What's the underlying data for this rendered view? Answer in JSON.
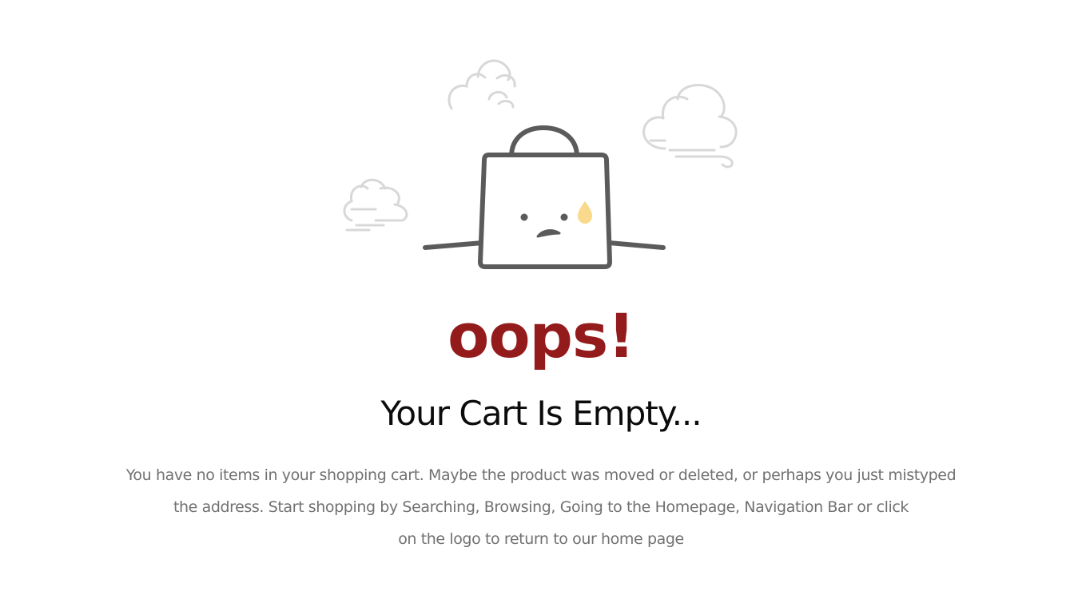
{
  "empty_cart": {
    "title": "oops!",
    "headline": "Your Cart Is Empty...",
    "message_lines": [
      "You have no items in your shopping cart. Maybe the product was moved or deleted, or perhaps you just mistyped",
      "the address. Start shopping by Searching, Browsing, Going to the Homepage, Navigation Bar or click",
      "on the logo to return to our home page"
    ]
  },
  "illustration": {
    "icon": "sad-shopping-bag-icon",
    "cloud_icon": "cloud-icon",
    "colors": {
      "bag": "#5b5b5b",
      "clouds": "#d8d8d8",
      "tear": "#f9d98b",
      "accent": "#941b1c"
    }
  }
}
